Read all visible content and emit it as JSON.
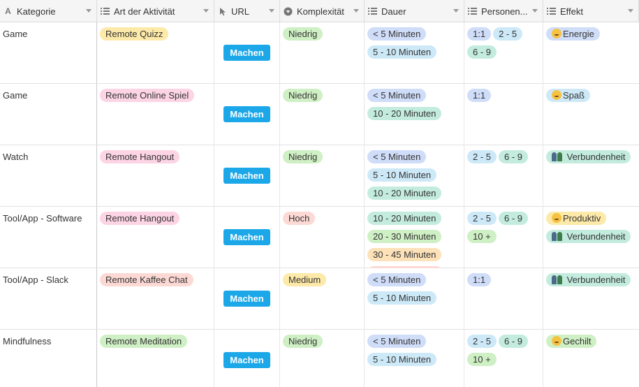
{
  "header": {
    "columns": [
      {
        "label": "Kategorie",
        "icon": "text-icon"
      },
      {
        "label": "Art der Aktivität",
        "icon": "list-icon"
      },
      {
        "label": "URL",
        "icon": "cursor-icon"
      },
      {
        "label": "Komplexität",
        "icon": "select-icon"
      },
      {
        "label": "Dauer",
        "icon": "list-icon"
      },
      {
        "label": "Personen...",
        "icon": "list-icon"
      },
      {
        "label": "Effekt",
        "icon": "list-icon"
      }
    ]
  },
  "colors": {
    "yellow": "#fde9a8",
    "pink": "#fcd4e4",
    "red": "#fcd9d4",
    "green": "#cfefc4",
    "blue": "#d0ddf8",
    "lightblue": "#cde9f8",
    "teal": "#c3ecdf",
    "orange": "#fde1b8",
    "button": "#1ba7e8"
  },
  "rows": [
    {
      "kategorie": "Game",
      "art": {
        "label": "Remote Quizz",
        "color": "yellow"
      },
      "url_button": "Machen",
      "komplexitaet": {
        "label": "Niedrig",
        "color": "green"
      },
      "dauer": [
        {
          "label": "< 5 Minuten",
          "color": "blue"
        },
        {
          "label": "5 - 10 Minuten",
          "color": "lightblue"
        }
      ],
      "personen": [
        {
          "label": "1:1",
          "color": "blue"
        },
        {
          "label": "2 - 5",
          "color": "lightblue"
        },
        {
          "label": "6 - 9",
          "color": "teal"
        }
      ],
      "effekt": [
        {
          "label": "Energie",
          "color": "blue",
          "emoji": "face"
        }
      ]
    },
    {
      "kategorie": "Game",
      "art": {
        "label": "Remote Online Spiel",
        "color": "pink"
      },
      "url_button": "Machen",
      "komplexitaet": {
        "label": "Niedrig",
        "color": "green"
      },
      "dauer": [
        {
          "label": "< 5 Minuten",
          "color": "blue"
        },
        {
          "label": "10 - 20 Minuten",
          "color": "teal"
        }
      ],
      "personen": [
        {
          "label": "1:1",
          "color": "blue"
        }
      ],
      "effekt": [
        {
          "label": "Spaß",
          "color": "lightblue",
          "emoji": "face"
        }
      ]
    },
    {
      "kategorie": "Watch",
      "art": {
        "label": "Remote Hangout",
        "color": "pink"
      },
      "url_button": "Machen",
      "komplexitaet": {
        "label": "Niedrig",
        "color": "green"
      },
      "dauer": [
        {
          "label": "< 5 Minuten",
          "color": "blue"
        },
        {
          "label": "5 - 10 Minuten",
          "color": "lightblue"
        },
        {
          "label": "10 - 20 Minuten",
          "color": "teal"
        }
      ],
      "personen": [
        {
          "label": "2 - 5",
          "color": "lightblue"
        },
        {
          "label": "6 - 9",
          "color": "teal"
        }
      ],
      "effekt": [
        {
          "label": " Verbundenheit",
          "color": "teal",
          "emoji": "people"
        }
      ]
    },
    {
      "kategorie": "Tool/App - Software",
      "art": {
        "label": "Remote Hangout",
        "color": "pink"
      },
      "url_button": "Machen",
      "komplexitaet": {
        "label": "Hoch",
        "color": "red"
      },
      "dauer": [
        {
          "label": "10 - 20 Minuten",
          "color": "teal"
        },
        {
          "label": "20 - 30 Minuten",
          "color": "green"
        },
        {
          "label": "30 - 45 Minuten",
          "color": "orange"
        },
        {
          "label": "",
          "color": "red"
        }
      ],
      "personen": [
        {
          "label": "2 - 5",
          "color": "lightblue"
        },
        {
          "label": "6 - 9",
          "color": "teal"
        },
        {
          "label": "10 +",
          "color": "green"
        }
      ],
      "effekt": [
        {
          "label": "Produktiv",
          "color": "yellow",
          "emoji": "face"
        },
        {
          "label": " Verbundenheit",
          "color": "teal",
          "emoji": "people"
        }
      ]
    },
    {
      "kategorie": "Tool/App - Slack",
      "art": {
        "label": "Remote Kaffee Chat",
        "color": "red"
      },
      "url_button": "Machen",
      "komplexitaet": {
        "label": "Medium",
        "color": "yellow"
      },
      "dauer": [
        {
          "label": "< 5 Minuten",
          "color": "blue"
        },
        {
          "label": "5 - 10 Minuten",
          "color": "lightblue"
        }
      ],
      "personen": [
        {
          "label": "1:1",
          "color": "blue"
        }
      ],
      "effekt": [
        {
          "label": " Verbundenheit",
          "color": "teal",
          "emoji": "people"
        }
      ]
    },
    {
      "kategorie": "Mindfulness",
      "art": {
        "label": "Remote Meditation",
        "color": "green"
      },
      "url_button": "Machen",
      "komplexitaet": {
        "label": "Niedrig",
        "color": "green"
      },
      "dauer": [
        {
          "label": "< 5 Minuten",
          "color": "blue"
        },
        {
          "label": "5 - 10 Minuten",
          "color": "lightblue"
        }
      ],
      "personen": [
        {
          "label": "2 - 5",
          "color": "lightblue"
        },
        {
          "label": "6 - 9",
          "color": "teal"
        },
        {
          "label": "10 +",
          "color": "green"
        }
      ],
      "effekt": [
        {
          "label": "Gechilt",
          "color": "green",
          "emoji": "face"
        }
      ]
    }
  ]
}
